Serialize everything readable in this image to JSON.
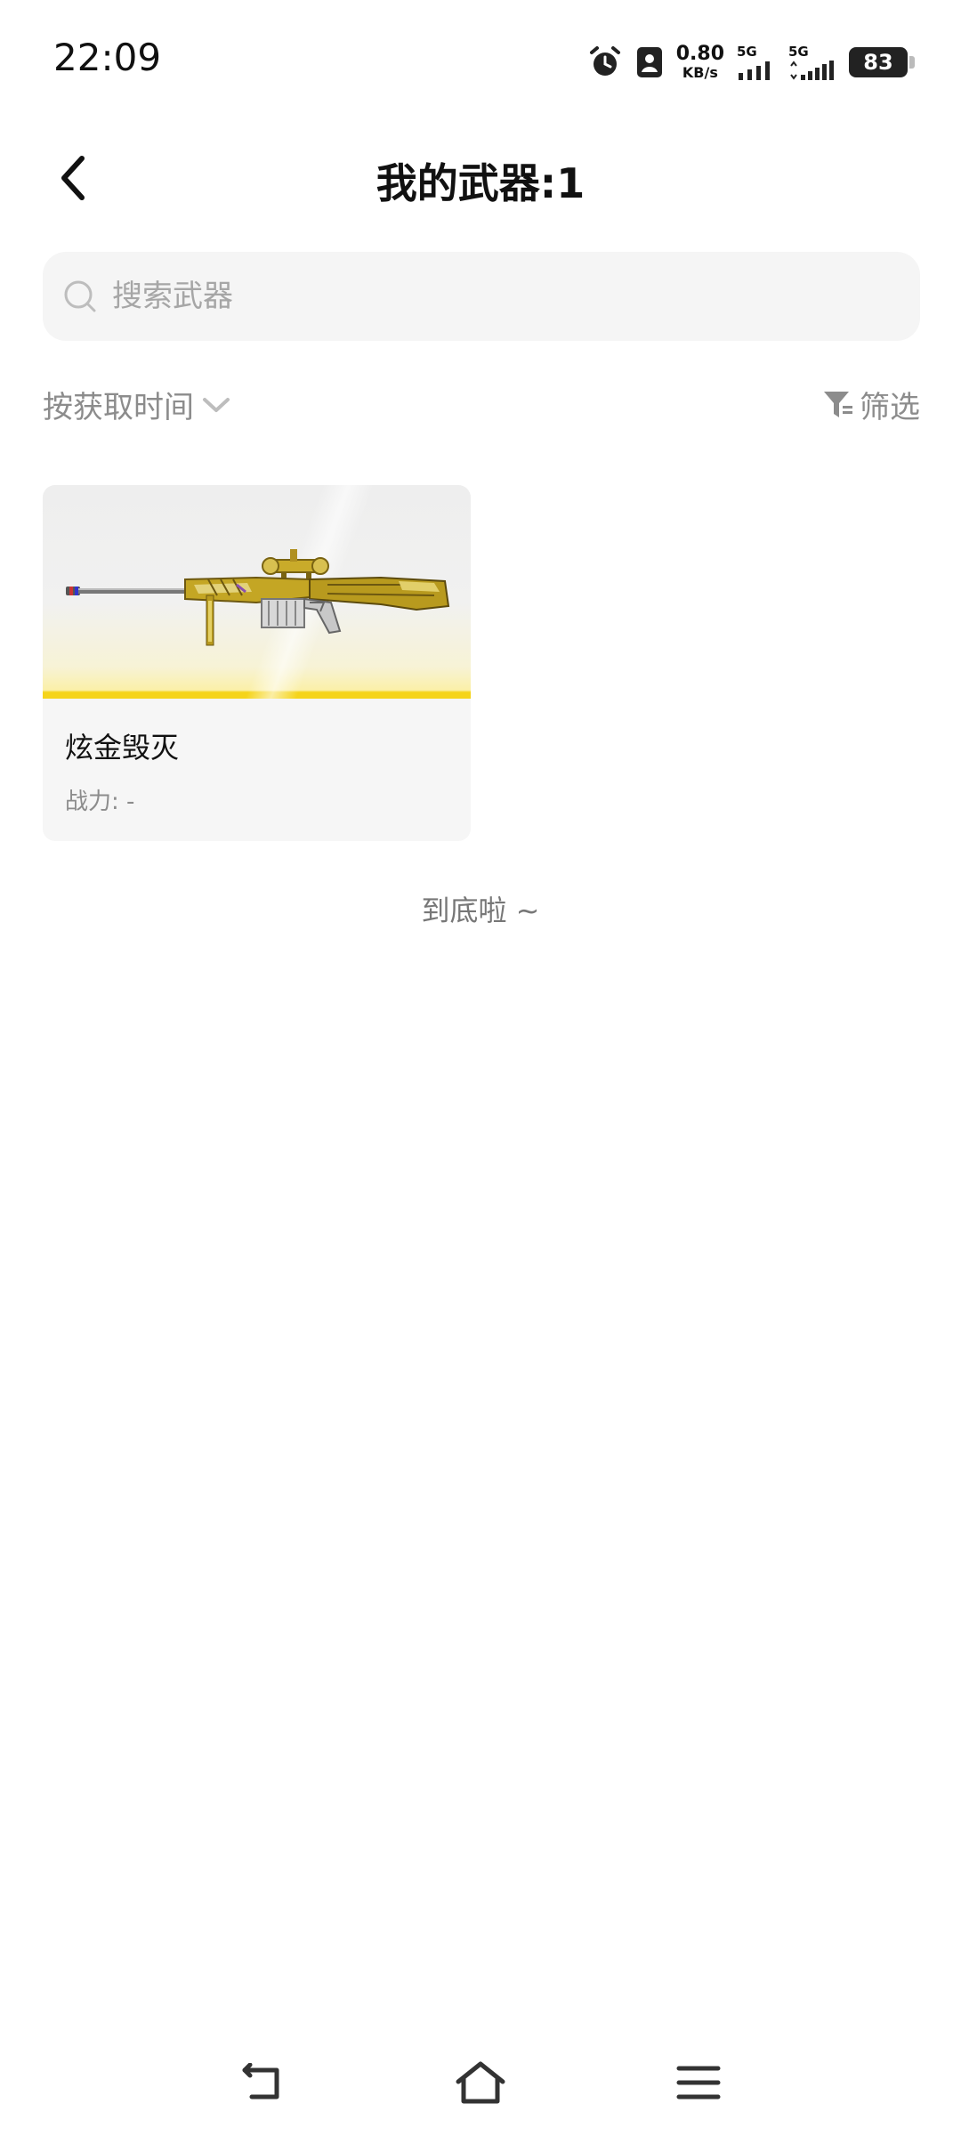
{
  "status_bar": {
    "time": "22:09",
    "net_speed_value": "0.80",
    "net_speed_unit": "KB/s",
    "sim1_label": "5G",
    "sim2_label": "5G",
    "battery_level": "83"
  },
  "header": {
    "title": "我的武器:1"
  },
  "search": {
    "placeholder": "搜索武器",
    "value": ""
  },
  "toolbar": {
    "sort_label": "按获取时间",
    "filter_label": "筛选"
  },
  "weapons": [
    {
      "name": "炫金毁灭",
      "power": "战力: -"
    }
  ],
  "list_end_text": "到底啦 ~",
  "colors": {
    "accent_yellow": "#f5d41a",
    "weapon_gold": "#b89a1e",
    "muted_text": "#8c8c8c",
    "search_bg": "#f5f5f5"
  },
  "icons": {
    "back": "chevron-left-icon",
    "search": "search-icon",
    "sort": "chevron-down-icon",
    "filter": "filter-icon",
    "nav_back": "nav-back-icon",
    "nav_home": "home-icon",
    "nav_menu": "menu-icon"
  }
}
